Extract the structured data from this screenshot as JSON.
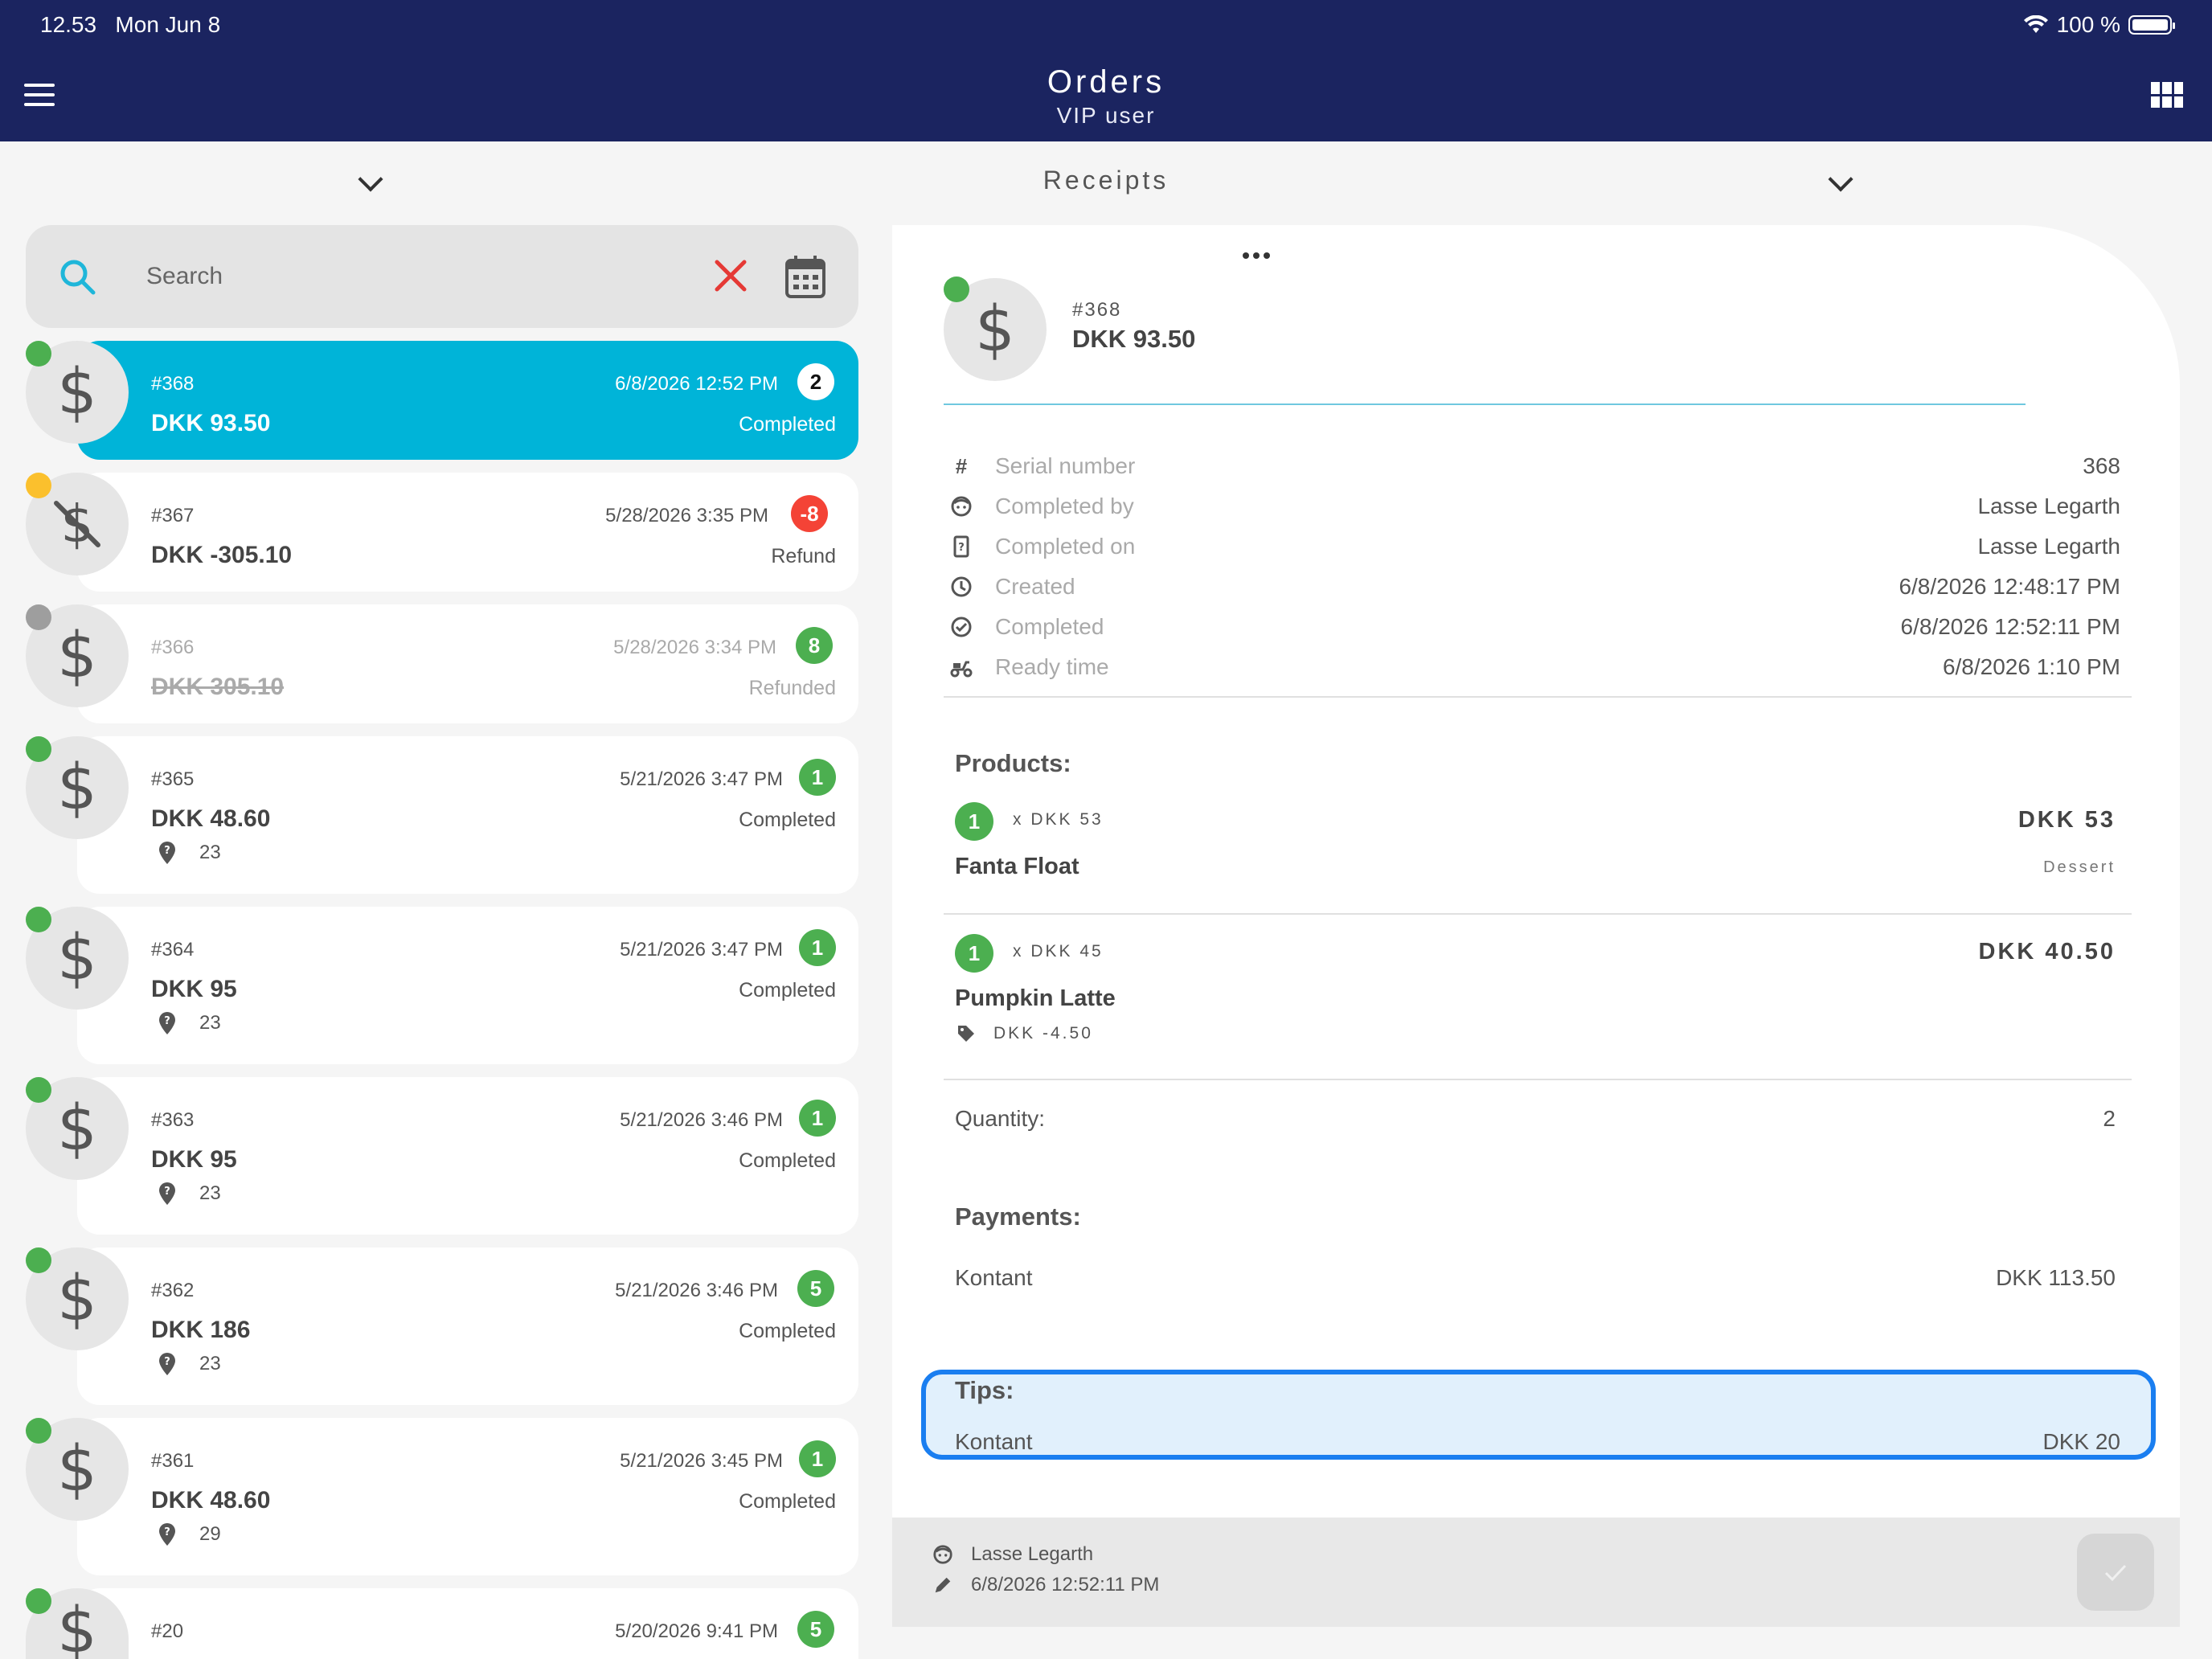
{
  "status_bar": {
    "time": "12.53",
    "date": "Mon Jun 8",
    "battery": "100 %"
  },
  "header": {
    "title": "Orders",
    "subtitle": "VIP user"
  },
  "section": {
    "title": "Receipts"
  },
  "search": {
    "placeholder": "Search",
    "value": ""
  },
  "orders": [
    {
      "number": "#368",
      "date": "6/8/2026 12:52 PM",
      "badge": "2",
      "amount": "DKK 93.50",
      "status": "Completed",
      "table": ""
    },
    {
      "number": "#367",
      "date": "5/28/2026 3:35 PM",
      "badge": "-8",
      "amount": "DKK -305.10",
      "status": "Refund",
      "table": ""
    },
    {
      "number": "#366",
      "date": "5/28/2026 3:34 PM",
      "badge": "8",
      "amount": "DKK 305.10",
      "status": "Refunded",
      "table": ""
    },
    {
      "number": "#365",
      "date": "5/21/2026 3:47 PM",
      "badge": "1",
      "amount": "DKK 48.60",
      "status": "Completed",
      "table": "23"
    },
    {
      "number": "#364",
      "date": "5/21/2026 3:47 PM",
      "badge": "1",
      "amount": "DKK 95",
      "status": "Completed",
      "table": "23"
    },
    {
      "number": "#363",
      "date": "5/21/2026 3:46 PM",
      "badge": "1",
      "amount": "DKK 95",
      "status": "Completed",
      "table": "23"
    },
    {
      "number": "#362",
      "date": "5/21/2026 3:46 PM",
      "badge": "5",
      "amount": "DKK 186",
      "status": "Completed",
      "table": "23"
    },
    {
      "number": "#361",
      "date": "5/21/2026 3:45 PM",
      "badge": "1",
      "amount": "DKK 48.60",
      "status": "Completed",
      "table": "29"
    },
    {
      "number": "#20",
      "date": "5/20/2026 9:41 PM",
      "badge": "5",
      "amount": "",
      "status": "",
      "table": ""
    }
  ],
  "icons": {
    "currency": "$"
  },
  "colors": {
    "header_bg": "#1b2460",
    "selected": "#00b4d8",
    "completed_dot": "#4caf50",
    "pending_dot": "#fbc02d",
    "inactive_dot": "#9e9e9e",
    "refund_badge": "#f44336",
    "highlight_border": "#1a7ef0"
  },
  "detail": {
    "number": "#368",
    "amount": "DKK 93.50",
    "info": [
      {
        "label": "Serial number",
        "value": "368"
      },
      {
        "label": "Completed by",
        "value": "Lasse Legarth"
      },
      {
        "label": "Completed on",
        "value": "Lasse Legarth"
      },
      {
        "label": "Created",
        "value": "6/8/2026 12:48:17 PM"
      },
      {
        "label": "Completed",
        "value": "6/8/2026 12:52:11 PM"
      },
      {
        "label": "Ready time",
        "value": "6/8/2026 1:10 PM"
      }
    ],
    "products_heading": "Products:",
    "products": [
      {
        "qty": "1",
        "unit_price": "x DKK 53",
        "price": "DKK 53",
        "name": "Fanta Float",
        "category": "Dessert",
        "discount": ""
      },
      {
        "qty": "1",
        "unit_price": "x DKK 45",
        "price": "DKK 40.50",
        "name": "Pumpkin Latte",
        "category": "",
        "discount": "DKK -4.50"
      }
    ],
    "quantity_label": "Quantity:",
    "quantity_value": "2",
    "payments_heading": "Payments:",
    "payment": {
      "method": "Kontant",
      "amount": "DKK 113.50"
    },
    "tips_heading": "Tips:",
    "tip": {
      "method": "Kontant",
      "amount": "DKK 20"
    },
    "footer": {
      "user": "Lasse Legarth",
      "edited": "6/8/2026 12:52:11 PM"
    }
  }
}
